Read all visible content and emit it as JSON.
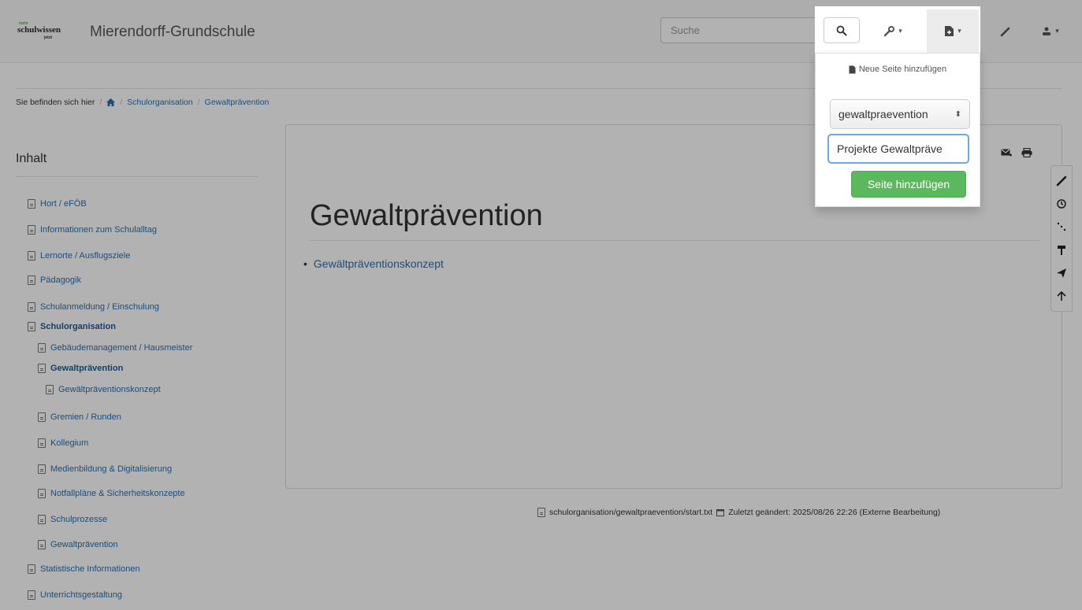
{
  "brand": {
    "logo_top": "mein",
    "logo_main": "schulwissen",
    "logo_sub": "jetzt",
    "site_title": "Mierendorff-Grundschule"
  },
  "navbar": {
    "search_placeholder": "Suche",
    "icons": [
      "search-icon",
      "wrench-icon",
      "page-icon",
      "pencil-icon",
      "user-icon"
    ]
  },
  "dropdown": {
    "header": "Neue Seite hinzufügen",
    "namespace_selected": "gewaltpraevention",
    "page_name_value": "Projekte Gewaltpräve",
    "submit_label": "Seite hinzufügen"
  },
  "breadcrumb": {
    "prefix": "Sie befinden sich hier",
    "items": [
      "Schulorganisation",
      "Gewaltprävention"
    ]
  },
  "sidebar": {
    "title": "Inhalt",
    "items": [
      {
        "label": "Hort / eFÖB"
      },
      {
        "label": "Informationen zum Schulalltag"
      },
      {
        "label": "Lernorte / Ausflugsziele"
      },
      {
        "label": "Pädagogik"
      },
      {
        "label": "Schulanmeldung / Einschulung"
      },
      {
        "label": "Schulorganisation"
      },
      {
        "label": "Gebäudemanagement / Hausmeister"
      },
      {
        "label": "Gewaltprävention"
      },
      {
        "label": "Gewältpräventionskonzept"
      },
      {
        "label": "Gremien / Runden"
      },
      {
        "label": "Kollegium"
      },
      {
        "label": "Medienbildung & Digitalisierung"
      },
      {
        "label": "Notfallpläne & Sicherheitskonzepte"
      },
      {
        "label": "Schulprozesse"
      },
      {
        "label": "Gewaltprävention"
      },
      {
        "label": "Statistische Informationen"
      },
      {
        "label": "Unterrichtsgestaltung"
      }
    ]
  },
  "main": {
    "title": "Gewaltprävention",
    "links": [
      "Gewältpräventionskonzept"
    ]
  },
  "footer": {
    "file_path": "schulorganisation/gewaltpraevention/start.txt",
    "last_modified": "Zuletzt geändert: 2025/08/26 22:26 (Externe Bearbeitung)"
  },
  "colors": {
    "link": "#2a6fb0",
    "submit": "#5cb85c",
    "input_focus": "#6ea8e0"
  }
}
